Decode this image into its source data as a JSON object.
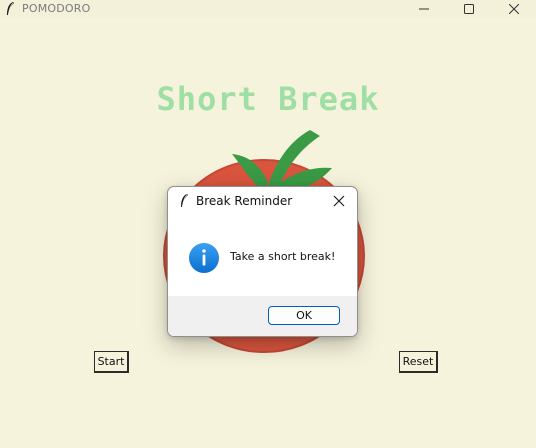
{
  "window": {
    "title": "POMODORO",
    "minimize_icon": "minimize-icon",
    "maximize_icon": "maximize-icon",
    "close_icon": "close-icon",
    "background": "#f6f3dc"
  },
  "main": {
    "heading": "Short Break",
    "heading_color": "#9fdfa5",
    "start_label": "Start",
    "reset_label": "Reset",
    "tomato_icon": "tomato-image"
  },
  "dialog": {
    "title": "Break Reminder",
    "message": "Take a short break!",
    "ok_label": "OK",
    "icon": "info-icon",
    "accent": "#005fb8"
  }
}
